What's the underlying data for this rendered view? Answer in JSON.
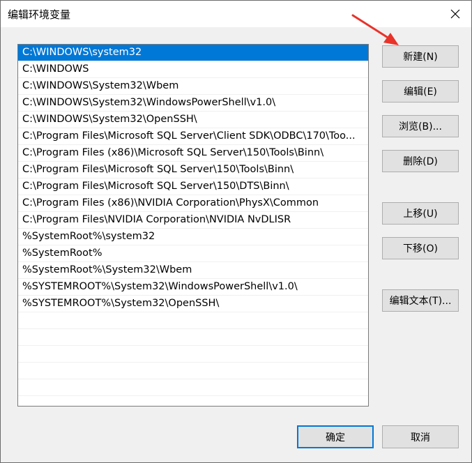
{
  "dialog": {
    "title": "编辑环境变量",
    "close_icon": "close-icon"
  },
  "list": {
    "items": [
      {
        "value": "C:\\WINDOWS\\system32",
        "selected": true
      },
      {
        "value": "C:\\WINDOWS",
        "selected": false
      },
      {
        "value": "C:\\WINDOWS\\System32\\Wbem",
        "selected": false
      },
      {
        "value": "C:\\WINDOWS\\System32\\WindowsPowerShell\\v1.0\\",
        "selected": false
      },
      {
        "value": "C:\\WINDOWS\\System32\\OpenSSH\\",
        "selected": false
      },
      {
        "value": "C:\\Program Files\\Microsoft SQL Server\\Client SDK\\ODBC\\170\\Too...",
        "selected": false
      },
      {
        "value": "C:\\Program Files (x86)\\Microsoft SQL Server\\150\\Tools\\Binn\\",
        "selected": false
      },
      {
        "value": "C:\\Program Files\\Microsoft SQL Server\\150\\Tools\\Binn\\",
        "selected": false
      },
      {
        "value": "C:\\Program Files\\Microsoft SQL Server\\150\\DTS\\Binn\\",
        "selected": false
      },
      {
        "value": "C:\\Program Files (x86)\\NVIDIA Corporation\\PhysX\\Common",
        "selected": false
      },
      {
        "value": "C:\\Program Files\\NVIDIA Corporation\\NVIDIA NvDLISR",
        "selected": false
      },
      {
        "value": "%SystemRoot%\\system32",
        "selected": false
      },
      {
        "value": "%SystemRoot%",
        "selected": false
      },
      {
        "value": "%SystemRoot%\\System32\\Wbem",
        "selected": false
      },
      {
        "value": "%SYSTEMROOT%\\System32\\WindowsPowerShell\\v1.0\\",
        "selected": false
      },
      {
        "value": "%SYSTEMROOT%\\System32\\OpenSSH\\",
        "selected": false
      }
    ],
    "selection_color": "#0078d7"
  },
  "buttons": {
    "new": "新建(N)",
    "edit": "编辑(E)",
    "browse": "浏览(B)...",
    "delete": "删除(D)",
    "move_up": "上移(U)",
    "move_down": "下移(O)",
    "edit_text": "编辑文本(T)...",
    "ok": "确定",
    "cancel": "取消"
  },
  "annotation": {
    "arrow_color": "#e8332a",
    "icon": "red-arrow-pointer"
  }
}
